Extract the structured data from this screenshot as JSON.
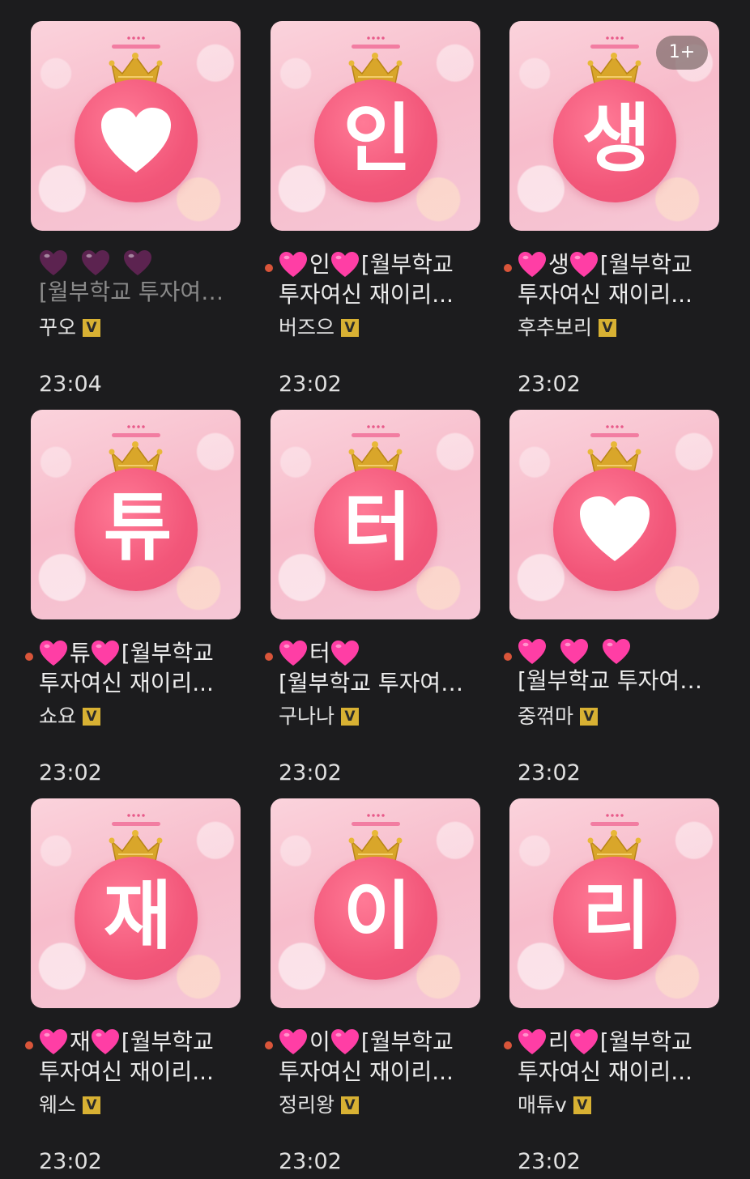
{
  "posts": [
    {
      "glyph": "",
      "glyph_type": "heart-icon",
      "new_badge": "",
      "title_hearts": 3,
      "title_hearts_style": "dark",
      "title_char": "",
      "title_rest": "",
      "title_line2": "[월부학교 투자여…",
      "read": true,
      "author": "꾸오",
      "time": "23:04"
    },
    {
      "glyph": "인",
      "glyph_type": "text",
      "new_badge": "",
      "title_hearts": 1,
      "title_hearts_style": "pink",
      "title_char": "인",
      "title_rest": "[월부학교",
      "title_line2": "투자여신 재이리...",
      "read": false,
      "author": "버즈으",
      "time": "23:02"
    },
    {
      "glyph": "생",
      "glyph_type": "text",
      "new_badge": "1+",
      "title_hearts": 1,
      "title_hearts_style": "pink",
      "title_char": "생",
      "title_rest": "[월부학교",
      "title_line2": "투자여신 재이리...",
      "read": false,
      "author": "후추보리",
      "time": "23:02"
    },
    {
      "glyph": "튜",
      "glyph_type": "text",
      "new_badge": "",
      "title_hearts": 1,
      "title_hearts_style": "pink",
      "title_char": "튜",
      "title_rest": "[월부학교",
      "title_line2": "투자여신 재이리...",
      "read": false,
      "author": "쇼요",
      "time": "23:02"
    },
    {
      "glyph": "터",
      "glyph_type": "text",
      "new_badge": "",
      "title_hearts": 1,
      "title_hearts_style": "pink",
      "title_char": "터",
      "title_rest": "",
      "title_line2": "[월부학교 투자여…",
      "read": false,
      "author": "구나나",
      "time": "23:02"
    },
    {
      "glyph": "",
      "glyph_type": "heart-icon",
      "new_badge": "",
      "title_hearts": 3,
      "title_hearts_style": "pink",
      "title_char": "",
      "title_rest": "",
      "title_line2": "[월부학교 투자여…",
      "read": false,
      "author": "중꺾마",
      "time": "23:02"
    },
    {
      "glyph": "재",
      "glyph_type": "text",
      "new_badge": "",
      "title_hearts": 1,
      "title_hearts_style": "pink",
      "title_char": "재",
      "title_rest": "[월부학교",
      "title_line2": "투자여신 재이리...",
      "read": false,
      "author": "웨스",
      "time": "23:02"
    },
    {
      "glyph": "이",
      "glyph_type": "text",
      "new_badge": "",
      "title_hearts": 1,
      "title_hearts_style": "pink",
      "title_char": "이",
      "title_rest": "[월부학교",
      "title_line2": "투자여신 재이리...",
      "read": false,
      "author": "정리왕",
      "time": "23:02"
    },
    {
      "glyph": "리",
      "glyph_type": "text",
      "new_badge": "",
      "title_hearts": 1,
      "title_hearts_style": "pink",
      "title_char": "리",
      "title_rest": "[월부학교",
      "title_line2": "투자여신 재이리...",
      "read": false,
      "author": "매튜v",
      "time": "23:02"
    }
  ],
  "verified_badge": "V",
  "colors": {
    "background": "#1c1c1e",
    "heart_pink": "#ff3ea5",
    "heart_dark": "#5c2350",
    "circle": "#f25679",
    "unread_dot": "#d9553a",
    "verified": "#d8b133"
  }
}
